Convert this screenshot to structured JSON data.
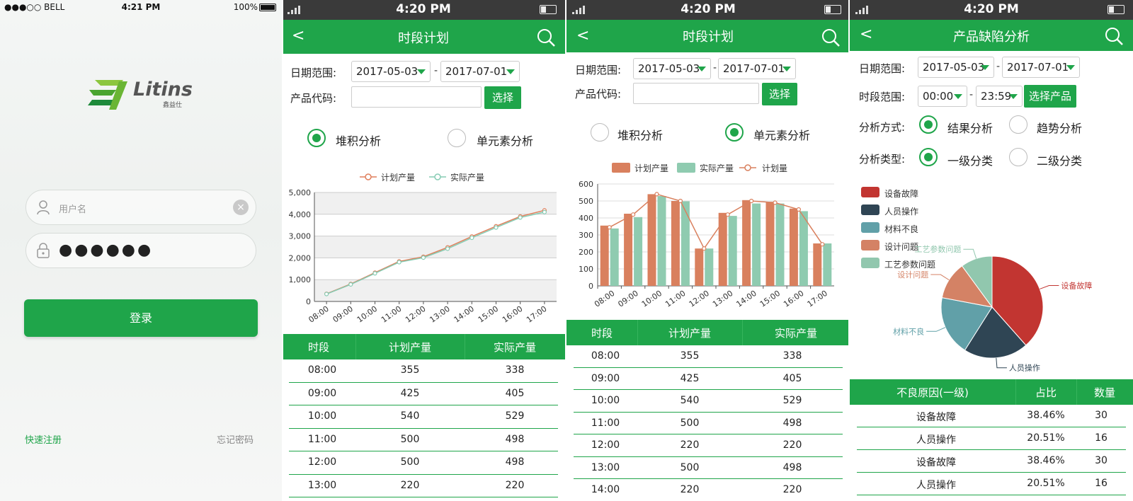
{
  "login": {
    "status": {
      "carrier": "●●●○○ BELL",
      "time": "4:21 PM",
      "battery": "100%"
    },
    "brand": {
      "name": "Litins",
      "sub": "鑫益仕"
    },
    "username_placeholder": "用户名",
    "password_masked": "●●●●●●",
    "login_label": "登录",
    "register_link": "快速注册",
    "forgot_link": "忘记密码"
  },
  "screen2": {
    "status_time": "4:20 PM",
    "title": "时段计划",
    "date_label": "日期范围:",
    "date_from": "2017-05-03",
    "date_sep": "-",
    "date_to": "2017-07-01",
    "product_label": "产品代码:",
    "select_button": "选择",
    "radio_stack": "堆积分析",
    "radio_unit": "单元素分析",
    "table_headers": [
      "时段",
      "计划产量",
      "实际产量"
    ],
    "rows": [
      [
        "08:00",
        "355",
        "338"
      ],
      [
        "09:00",
        "425",
        "405"
      ],
      [
        "10:00",
        "540",
        "529"
      ],
      [
        "11:00",
        "500",
        "498"
      ],
      [
        "12:00",
        "500",
        "498"
      ],
      [
        "13:00",
        "220",
        "220"
      ]
    ]
  },
  "screen3": {
    "status_time": "4:20 PM",
    "title": "时段计划",
    "date_label": "日期范围:",
    "date_from": "2017-05-03",
    "date_sep": "-",
    "date_to": "2017-07-01",
    "product_label": "产品代码:",
    "select_button": "选择",
    "radio_stack": "堆积分析",
    "radio_unit": "单元素分析",
    "table_headers": [
      "时段",
      "计划产量",
      "实际产量"
    ],
    "rows": [
      [
        "08:00",
        "355",
        "338"
      ],
      [
        "09:00",
        "425",
        "405"
      ],
      [
        "10:00",
        "540",
        "529"
      ],
      [
        "11:00",
        "500",
        "498"
      ],
      [
        "12:00",
        "220",
        "220"
      ],
      [
        "13:00",
        "500",
        "498"
      ],
      [
        "14:00",
        "220",
        "220"
      ]
    ]
  },
  "screen4": {
    "status_time": "4:20 PM",
    "title": "产品缺陷分析",
    "date_label": "日期范围:",
    "date_from": "2017-05-03",
    "date_sep": "-",
    "date_to": "2017-07-01",
    "period_label": "时段范围:",
    "period_from": "00:00",
    "period_to": "23:59",
    "select_product": "选择产品",
    "method_label": "分析方式:",
    "method_result": "结果分析",
    "method_trend": "趋势分析",
    "type_label": "分析类型:",
    "type_level1": "一级分类",
    "type_level2": "二级分类",
    "table_headers": [
      "不良原因(一级)",
      "占比",
      "数量"
    ],
    "rows": [
      [
        "设备故障",
        "38.46%",
        "30"
      ],
      [
        "人员操作",
        "20.51%",
        "16"
      ],
      [
        "设备故障",
        "38.46%",
        "30"
      ],
      [
        "人员操作",
        "20.51%",
        "16"
      ]
    ]
  },
  "chart_data": [
    {
      "type": "line",
      "categories": [
        "08:00",
        "09:00",
        "10:00",
        "11:00",
        "12:00",
        "13:00",
        "14:00",
        "15:00",
        "16:00",
        "17:00"
      ],
      "series": [
        {
          "name": "计划产量",
          "values": [
            350,
            800,
            1320,
            1840,
            2050,
            2480,
            2980,
            3450,
            3900,
            4180
          ],
          "color": "#e07f5c"
        },
        {
          "name": "实际产量",
          "values": [
            340,
            780,
            1290,
            1800,
            2010,
            2420,
            2920,
            3390,
            3850,
            4100
          ],
          "color": "#86ccb4"
        }
      ],
      "ylim": [
        0,
        5000
      ],
      "yticks": [
        "0",
        "1,000",
        "2,000",
        "3,000",
        "4,000",
        "5,000"
      ],
      "grid": true,
      "legend": "top"
    },
    {
      "type": "bar",
      "categories": [
        "08:00",
        "09:00",
        "10:00",
        "11:00",
        "12:00",
        "13:00",
        "14:00",
        "15:00",
        "16:00",
        "17:00"
      ],
      "series": [
        {
          "name": "计划产量",
          "values": [
            355,
            425,
            540,
            500,
            220,
            430,
            505,
            495,
            455,
            250
          ],
          "color": "#d9805e"
        },
        {
          "name": "实际产量",
          "values": [
            338,
            405,
            529,
            498,
            220,
            412,
            485,
            485,
            440,
            250
          ],
          "color": "#8fcbb0"
        },
        {
          "name": "计划量",
          "values": [
            345,
            420,
            540,
            500,
            220,
            420,
            500,
            490,
            450,
            245
          ],
          "color": "#d9805e",
          "kind": "line"
        }
      ],
      "ylim": [
        0,
        600
      ],
      "yticks": [
        "0",
        "100",
        "200",
        "300",
        "400",
        "500",
        "600"
      ],
      "legend": "top"
    },
    {
      "type": "pie",
      "slices": [
        {
          "name": "设备故障",
          "value": 38.46,
          "color": "#c23531"
        },
        {
          "name": "人员操作",
          "value": 20.51,
          "color": "#2f4554"
        },
        {
          "name": "材料不良",
          "value": 19.0,
          "color": "#61a0a8"
        },
        {
          "name": "设计问题",
          "value": 12.0,
          "color": "#d48265"
        },
        {
          "name": "工艺参数问题",
          "value": 10.03,
          "color": "#91c7ae"
        }
      ],
      "legend": "top-left"
    }
  ]
}
